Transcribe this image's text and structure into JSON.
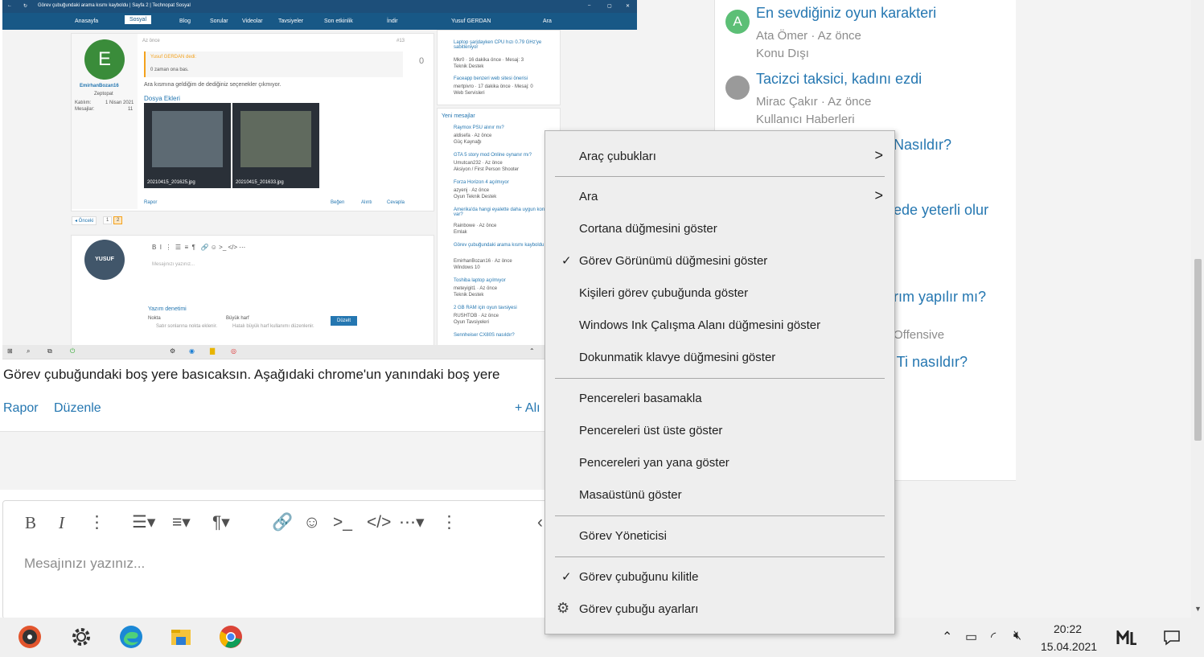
{
  "embedded": {
    "window_title": "Görev çubuğundaki arama kısmı kayboldu | Sayfa 2 | Technopat Sosyal",
    "nav": [
      "Anasayfa",
      "Sosyal",
      "Blog",
      "Sorular",
      "Videolar",
      "Tavsiyeler",
      "Son etkinlik",
      "İndir",
      "Yusuf GERDAN",
      "Ara"
    ],
    "post": {
      "avatar_letter": "E",
      "username": "EmirhanBozan16",
      "user_title": "Zeptopat",
      "joined_label": "Katılım:",
      "joined_value": "1 Nisan 2021",
      "messages_label": "Mesajlar:",
      "messages_value": "11",
      "time": "Az önce",
      "number": "#13",
      "quote_author": "Yusuf GERDAN dedi:",
      "quote_text": "0 zaman ona bas.",
      "body": "Ara kısmına geldiğim de dediğiniz seçenekler çıkmıyor.",
      "attachments_title": "Dosya Ekleri",
      "attachment1": "20210415_201625.jpg",
      "attachment2": "20210415_201633.jpg",
      "report": "Rapor",
      "like": "Beğen",
      "quote": "Alıntı",
      "reply": "Cevapla",
      "score": "0"
    },
    "pagination": {
      "prev": "◂ Önceki",
      "p1": "1",
      "p2": "2"
    },
    "editor": {
      "avatar_text": "YUSUF",
      "placeholder": "Mesajınızı yazınız...",
      "spell_title": "Yazım denetimi",
      "opt1": "Nokta",
      "opt1_desc": "Satır sonlarına nokta eklenir.",
      "opt2": "Büyük harf",
      "opt2_desc": "Hatalı büyük harf kullanımı düzenlenir.",
      "fix_button": "Düzelt"
    },
    "right_top": [
      {
        "title": "Laptop şarjdayken CPU hızı 0.79 GHz'ye sabitleniyor",
        "meta": "Mkr0 · 16 dakika önce · Mesaj: 3",
        "forum": "Teknik Destek"
      },
      {
        "title": "Faceapp benzeri web sitesi önerisi",
        "meta": "mertpivro · 17 dakika önce · Mesaj: 0",
        "forum": "Web Servisleri"
      }
    ],
    "new_messages_title": "Yeni mesajlar",
    "new_messages": [
      {
        "title": "Raymox PSU alınır mı?",
        "meta": "aldisefa · Az önce",
        "forum": "Güç Kaynağı"
      },
      {
        "title": "GTA 5 story mod Online oynanır mı?",
        "meta": "Umutcan232 · Az önce",
        "forum": "Aksiyon / First Person Shooter"
      },
      {
        "title": "Forza Horizon 4 açılmıyor",
        "meta": "azyenj · Az önce",
        "forum": "Oyun Teknik Destek"
      },
      {
        "title": "Amerika'da hangi eyalette daha uygun konut var?",
        "meta": "Rainbowe · Az önce",
        "forum": "Emlak"
      },
      {
        "title": "Görev çubuğundaki arama kısmı kayboldu",
        "meta": "EmirhanBozan16 · Az önce",
        "forum": "Windows 10"
      },
      {
        "title": "Toshiba laptop açılmıyor",
        "meta": "meteyigit1 · Az önce",
        "forum": "Teknik Destek"
      },
      {
        "title": "2 GB RAM için oyun tavsiyesi",
        "meta": "RUSHTOB · Az önce",
        "forum": "Oyun Tavsiyeleri"
      },
      {
        "title": "Sennheiser CX80S nasıldır?",
        "meta": "",
        "forum": ""
      }
    ]
  },
  "post_text": "Görev çubuğundaki boş yere basıcaksın. Aşağıdaki chrome'un yanındaki boş yere",
  "post_actions": {
    "report": "Rapor",
    "edit": "Düzenle",
    "quote": "+ Alı"
  },
  "editor": {
    "placeholder": "Mesajınızı yazınız..."
  },
  "sidebar": {
    "items": [
      {
        "avatar_letter": "A",
        "title": "En sevdiğiniz oyun karakteri",
        "meta": "Ata Ömer · Az önce",
        "forum": "Konu Dışı"
      },
      {
        "title": "Tacizci taksici, kadını ezdi",
        "meta": "Mirac Çakır · Az önce",
        "forum": "Kullanıcı Haberleri"
      }
    ],
    "partial_titles": [
      "Nasıldır?",
      "ede yeterli olur",
      "rım yapılır mı?",
      ") Ti nasıldır?"
    ],
    "partial_meta": [
      "Offensive"
    ]
  },
  "context_menu": {
    "items": [
      {
        "label": "Araç çubukları",
        "submenu": true
      },
      {
        "label": "Ara",
        "submenu": true
      },
      {
        "label": "Cortana düğmesini göster"
      },
      {
        "label": "Görev Görünümü düğmesini göster",
        "checked": true
      },
      {
        "label": "Kişileri görev çubuğunda göster"
      },
      {
        "label": "Windows Ink Çalışma Alanı düğmesini göster"
      },
      {
        "label": "Dokunmatik klavye düğmesini göster"
      },
      {
        "label": "Pencereleri basamakla"
      },
      {
        "label": "Pencereleri üst üste göster"
      },
      {
        "label": "Pencereleri yan yana göster"
      },
      {
        "label": "Masaüstünü göster"
      },
      {
        "label": "Görev Yöneticisi"
      },
      {
        "label": "Görev çubuğunu kilitle",
        "checked": true
      },
      {
        "label": "Görev çubuğu ayarları",
        "icon": "gear-icon"
      }
    ]
  },
  "taskbar": {
    "time": "20:22",
    "date": "15.04.2021",
    "apps": [
      "media-player-icon",
      "settings-gear-icon",
      "edge-icon",
      "file-explorer-icon",
      "chrome-icon"
    ]
  },
  "colors": {
    "link": "#2577b1",
    "nav": "#185886",
    "menu_bg": "#eeeeee"
  }
}
